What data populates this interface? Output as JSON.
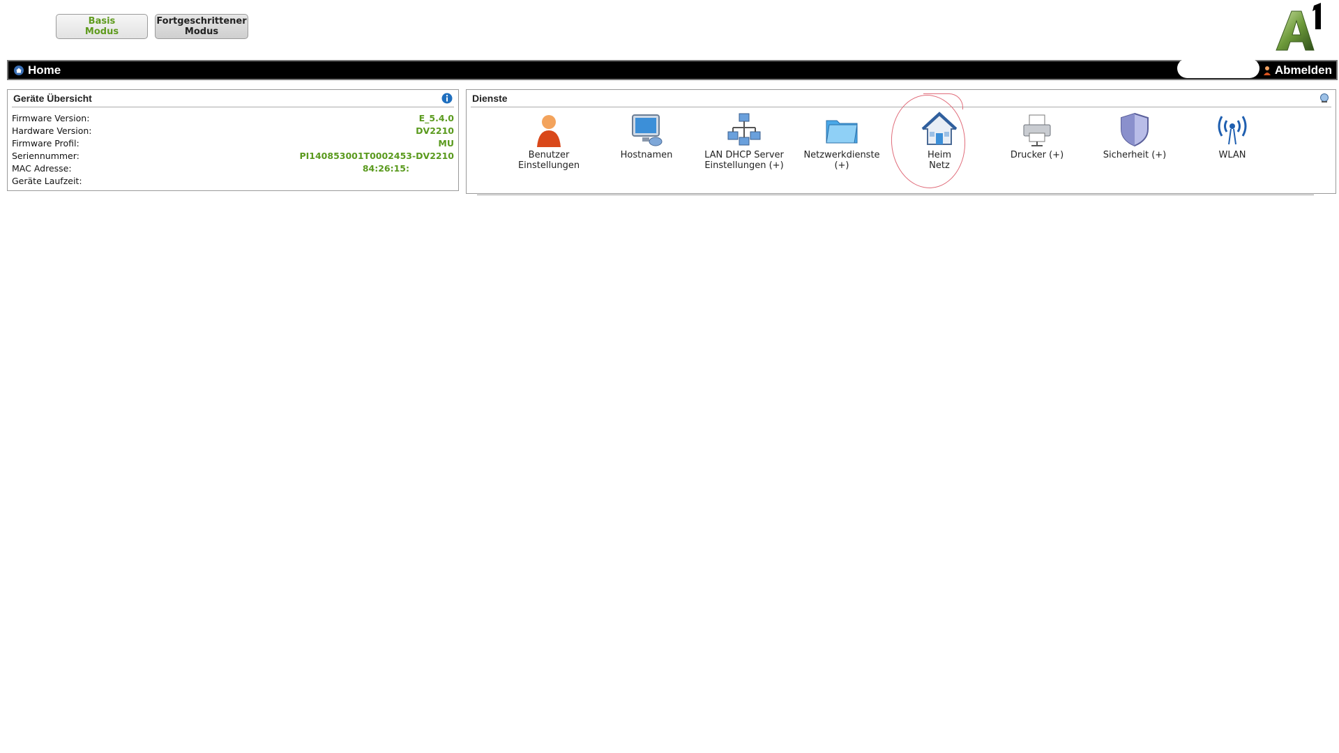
{
  "mode_buttons": {
    "basis": "Basis\nModus",
    "fortgeschritten": "Fortgeschrittener\nModus"
  },
  "topbar": {
    "home_label": "Home",
    "logout_label": "Abmelden"
  },
  "device_overview": {
    "title": "Geräte Übersicht",
    "rows": [
      {
        "label": "Firmware Version:",
        "value": "E_5.4.0"
      },
      {
        "label": "Hardware Version:",
        "value": "DV2210"
      },
      {
        "label": "Firmware Profil:",
        "value": "MU"
      },
      {
        "label": "Seriennummer:",
        "value": "PI140853001T0002453-DV2210"
      },
      {
        "label": "MAC Adresse:",
        "value": "84:26:15:"
      },
      {
        "label": "Geräte Laufzeit:",
        "value": ""
      }
    ]
  },
  "services": {
    "title": "Dienste",
    "items": [
      {
        "label": "Benutzer\nEinstellungen",
        "icon": "user-icon"
      },
      {
        "label": "Hostnamen",
        "icon": "monitor-icon"
      },
      {
        "label": "LAN DHCP Server\nEinstellungen (+)",
        "icon": "network-icon"
      },
      {
        "label": "Netzwerkdienste\n(+)",
        "icon": "folder-icon"
      },
      {
        "label": "Heim\nNetz",
        "icon": "house-icon"
      },
      {
        "label": "Drucker (+)",
        "icon": "printer-icon"
      },
      {
        "label": "Sicherheit (+)",
        "icon": "shield-icon"
      },
      {
        "label": "WLAN",
        "icon": "wifi-icon"
      }
    ]
  },
  "colors": {
    "accent_green": "#5a9a1e",
    "bar": "#000000"
  }
}
